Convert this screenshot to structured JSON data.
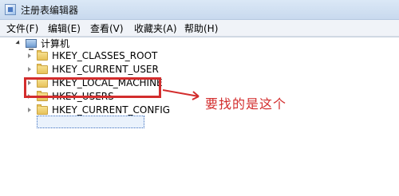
{
  "window": {
    "title": "注册表编辑器",
    "icon": "registry-editor-icon"
  },
  "menu": {
    "items": [
      "文件(F)",
      "编辑(E)",
      "查看(V)",
      "收藏夹(A)",
      "帮助(H)"
    ]
  },
  "tree": {
    "root": {
      "label": "计算机",
      "icon": "computer-icon",
      "expanded": true
    },
    "nodes": [
      {
        "label": "HKEY_CLASSES_ROOT",
        "icon": "folder-icon"
      },
      {
        "label": "HKEY_CURRENT_USER",
        "icon": "folder-icon"
      },
      {
        "label": "HKEY_LOCAL_MACHINE",
        "icon": "folder-icon",
        "selected": true
      },
      {
        "label": "HKEY_USERS",
        "icon": "folder-icon"
      },
      {
        "label": "HKEY_CURRENT_CONFIG",
        "icon": "folder-icon"
      }
    ]
  },
  "annotation": {
    "text": "要找的是这个",
    "color": "#d32d2d"
  }
}
